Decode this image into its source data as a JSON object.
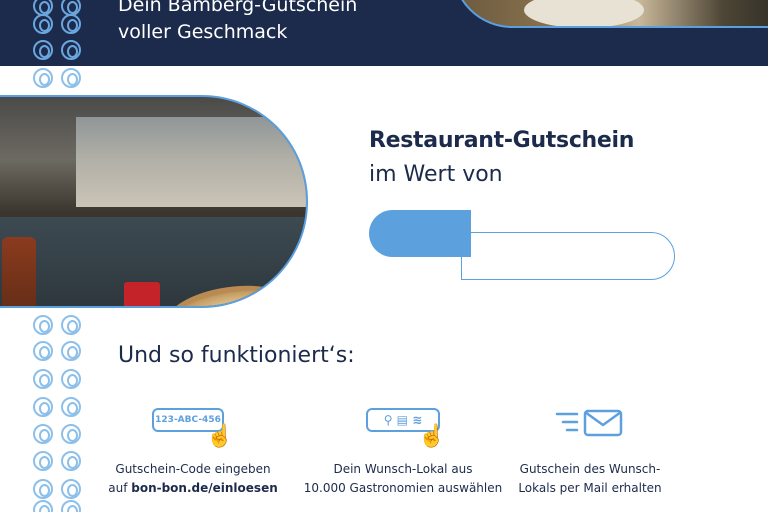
{
  "header": {
    "line1": "Dein Bamberg-Gutschein",
    "line2": "voller Geschmack"
  },
  "voucher": {
    "title": "Restaurant-Gutschein",
    "subtitle": "im Wert von",
    "value": ""
  },
  "how": {
    "title": "Und so funktioniert‘s:",
    "steps": [
      {
        "icon": "code-entry-icon",
        "code": "123-ABC-456",
        "line1": "Gutschein-Code eingeben",
        "line2_prefix": "auf ",
        "line2_bold": "bon-bon.de/einloesen"
      },
      {
        "icon": "restaurant-select-icon",
        "icon_glyphs": "⚲ ▤ ≋",
        "line1": "Dein Wunsch-Lokal aus",
        "line2": "10.000 Gastronomien auswählen"
      },
      {
        "icon": "mail-icon",
        "line1": "Gutschein des Wunsch-",
        "line2": "Lokals per Mail erhalten"
      }
    ]
  },
  "colors": {
    "navy": "#1c2b4b",
    "accent_blue": "#5da0de",
    "light_blue": "#8cc0ea",
    "white": "#ffffff"
  }
}
